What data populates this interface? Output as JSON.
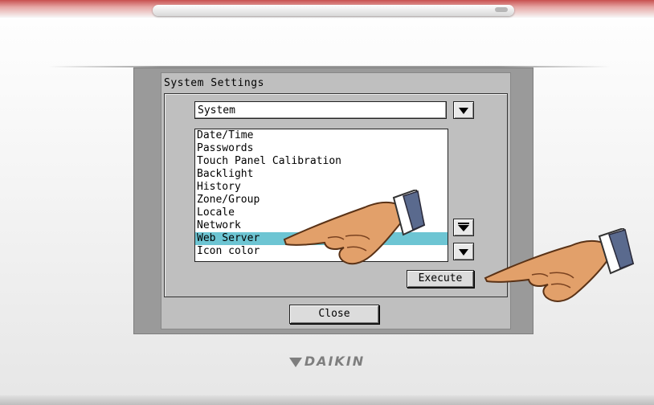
{
  "window": {
    "title": "System Settings"
  },
  "category": {
    "value": "System"
  },
  "menu": {
    "items": [
      "Date/Time",
      "Passwords",
      "Touch Panel Calibration",
      "Backlight",
      "History",
      "Zone/Group",
      "Locale",
      "Network",
      "Web Server",
      "Icon color"
    ],
    "selected_index": 8
  },
  "buttons": {
    "execute": "Execute",
    "close": "Close"
  },
  "brand": {
    "name": "DAIKIN"
  },
  "colors": {
    "selection": "#6dc5d3",
    "screen": "#bfbfbf",
    "frame": "#9a9a9a",
    "brand": "#7e7e7e"
  },
  "icons": {
    "dropdown": "triangle-down-icon",
    "scroll_page": "scroll-page-down-icon",
    "scroll_down": "scroll-down-icon",
    "pointer": "pointing-hand-icon"
  }
}
